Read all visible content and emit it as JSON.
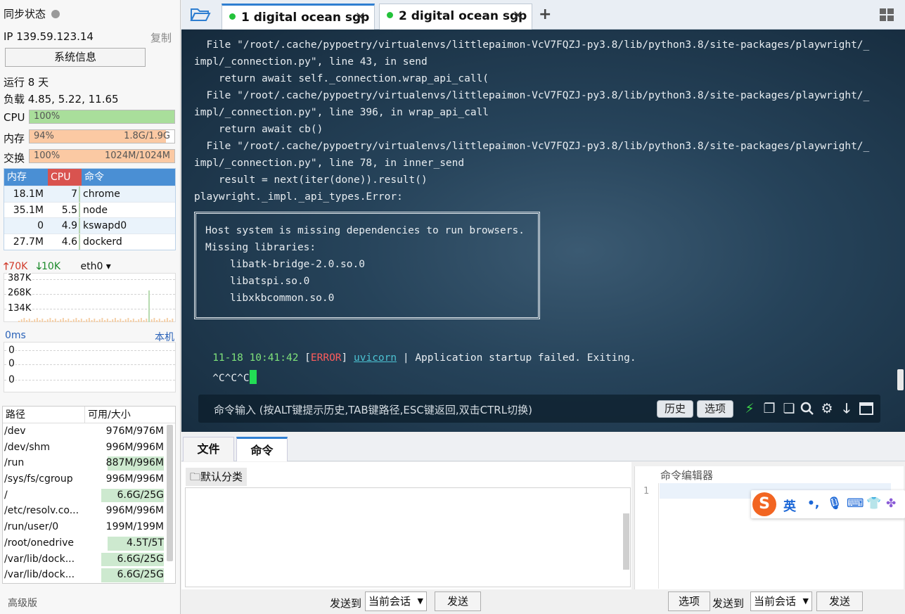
{
  "sidebar": {
    "sync_status": "同步状态",
    "ip": "IP 139.59.123.14",
    "copy": "复制",
    "sysinfo_button": "系统信息",
    "uptime": "运行 8 天",
    "load": "负载 4.85, 5.22, 11.65",
    "cpu": {
      "label": "CPU",
      "text": "100%",
      "value": 1.0,
      "color": "#a9de9b"
    },
    "mem": {
      "label": "内存",
      "text": "94%",
      "detail": "1.8G/1.9G",
      "value": 0.94,
      "color": "#fbc9a3"
    },
    "swap": {
      "label": "交换",
      "text": "100%",
      "detail": "1024M/1024M",
      "value": 1.0,
      "color": "#fbc9a3"
    },
    "proc_headers": {
      "mem": "内存",
      "cpu": "CPU",
      "cmd": "命令"
    },
    "processes": [
      {
        "mem": "18.1M",
        "cpu": "7",
        "cmd": "chrome"
      },
      {
        "mem": "35.1M",
        "cpu": "5.5",
        "cmd": "node"
      },
      {
        "mem": "0",
        "cpu": "4.9",
        "cmd": "kswapd0"
      },
      {
        "mem": "27.7M",
        "cpu": "4.6",
        "cmd": "dockerd"
      }
    ],
    "net": {
      "up": "70K",
      "down": "10K",
      "iface": "eth0",
      "ticks": [
        "387K",
        "268K",
        "134K"
      ]
    },
    "latency": {
      "ms": "0ms",
      "host": "本机",
      "values": [
        "0",
        "0",
        "0"
      ]
    },
    "disk_headers": {
      "path": "路径",
      "size": "可用/大小"
    },
    "disks": [
      {
        "path": "/dev",
        "size": "976M/976M",
        "used": 0.0
      },
      {
        "path": "/dev/shm",
        "size": "996M/996M",
        "used": 0.0
      },
      {
        "path": "/run",
        "size": "887M/996M",
        "used": 0.11
      },
      {
        "path": "/sys/fs/cgroup",
        "size": "996M/996M",
        "used": 0.0
      },
      {
        "path": "/",
        "size": "6.6G/25G",
        "used": 0.74
      },
      {
        "path": "/etc/resolv.co...",
        "size": "996M/996M",
        "used": 0.0
      },
      {
        "path": "/run/user/0",
        "size": "199M/199M",
        "used": 0.0
      },
      {
        "path": "/root/onedrive",
        "size": "4.5T/5T",
        "used": 0.1
      },
      {
        "path": "/var/lib/dock...",
        "size": "6.6G/25G",
        "used": 0.74
      },
      {
        "path": "/var/lib/dock...",
        "size": "6.6G/25G",
        "used": 0.74
      }
    ],
    "edition": "高级版"
  },
  "tabs": [
    {
      "label": "1  digital ocean sgp",
      "active": true
    },
    {
      "label": "2  digital ocean sgp",
      "active": false
    }
  ],
  "terminal": {
    "lines": [
      "  File \"/root/.cache/pypoetry/virtualenvs/littlepaimon-VcV7FQZJ-py3.8/lib/python3.8/site-packages/playwright/_",
      "impl/_connection.py\", line 43, in send",
      "    return await self._connection.wrap_api_call(",
      "  File \"/root/.cache/pypoetry/virtualenvs/littlepaimon-VcV7FQZJ-py3.8/lib/python3.8/site-packages/playwright/_",
      "impl/_connection.py\", line 396, in wrap_api_call",
      "    return await cb()",
      "  File \"/root/.cache/pypoetry/virtualenvs/littlepaimon-VcV7FQZJ-py3.8/lib/python3.8/site-packages/playwright/_",
      "impl/_connection.py\", line 78, in inner_send",
      "    result = next(iter(done)).result()",
      "playwright._impl._api_types.Error:"
    ],
    "box_lines": [
      "Host system is missing dependencies to run browsers.",
      "Missing libraries:",
      "    libatk-bridge-2.0.so.0",
      "    libatspi.so.0",
      "    libxkbcommon.so.0"
    ],
    "log_time": "11-18 10:41:42",
    "log_level": "ERROR",
    "log_source": "uvicorn",
    "log_msg": " | Application startup failed. Exiting.",
    "prompt_line": "^C^C^C",
    "input_placeholder": "命令输入 (按ALT键提示历史,TAB键路径,ESC键返回,双击CTRL切换)",
    "history_button": "历史",
    "options_button": "选项"
  },
  "bottom": {
    "tab_files": "文件",
    "tab_commands": "命令",
    "category": "默认分类",
    "editor_title": "命令编辑器",
    "editor_line": "1",
    "options": "选项",
    "send_to": "发送到",
    "session": "当前会话",
    "send": "发送"
  },
  "ime": {
    "lang": "英",
    "punct": "•,"
  }
}
